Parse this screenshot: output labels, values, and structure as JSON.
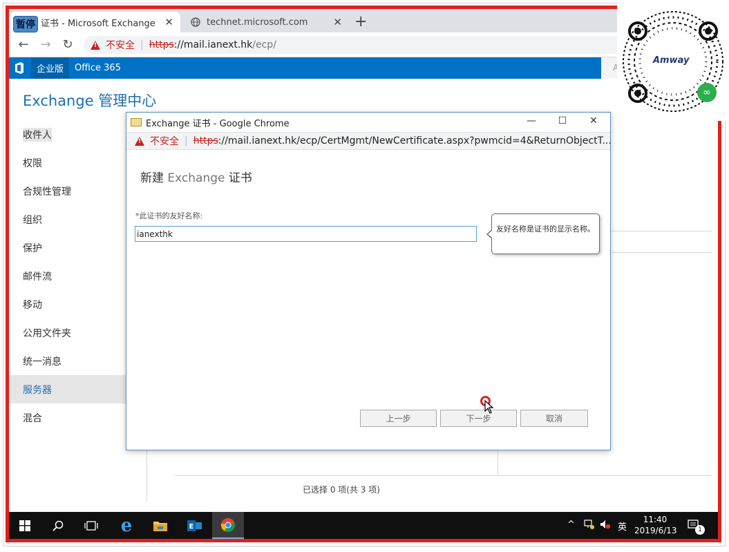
{
  "browser": {
    "tabs": [
      {
        "badge": "暂停",
        "title": "证书 - Microsoft Exchange",
        "close": "✕"
      },
      {
        "title": "technet.microsoft.com",
        "close": "✕"
      }
    ],
    "new_tab": "+",
    "address": {
      "insecure_label": "不安全",
      "scheme": "https",
      "host": "://mail.ianext.hk",
      "path": "/ecp/"
    }
  },
  "eac": {
    "topbar": {
      "nav_active": "企业版",
      "nav_other": "Office 365",
      "right_letter": "A"
    },
    "title": "Exchange 管理中心",
    "sidebar": [
      "收件人",
      "权限",
      "合规性管理",
      "组织",
      "保护",
      "邮件流",
      "移动",
      "公用文件夹",
      "统一消息",
      "服务器",
      "混合"
    ],
    "selected_item": "服务器",
    "status": "已选择 0 项(共 3 项)"
  },
  "dialog": {
    "window_title": "Exchange 证书 - Google Chrome",
    "address": {
      "insecure_label": "不安全",
      "scheme": "https",
      "rest": "://mail.ianext.hk/ecp/CertMgmt/NewCertificate.aspx?pwmcid=4&ReturnObjectT..."
    },
    "heading_prefix": "新建",
    "heading_en": "Exchange",
    "heading_suffix": "证书",
    "field_label": "*此证书的友好名称:",
    "field_value": "ianexthk",
    "tooltip": "友好名称是证书的显示名称。",
    "buttons": {
      "back": "上一步",
      "next": "下一步",
      "cancel": "取消"
    }
  },
  "taskbar": {
    "ime": "英",
    "time": "11:40",
    "date": "2019/6/13",
    "notification_count": "1"
  },
  "overlay": {
    "brand": "Amway"
  }
}
